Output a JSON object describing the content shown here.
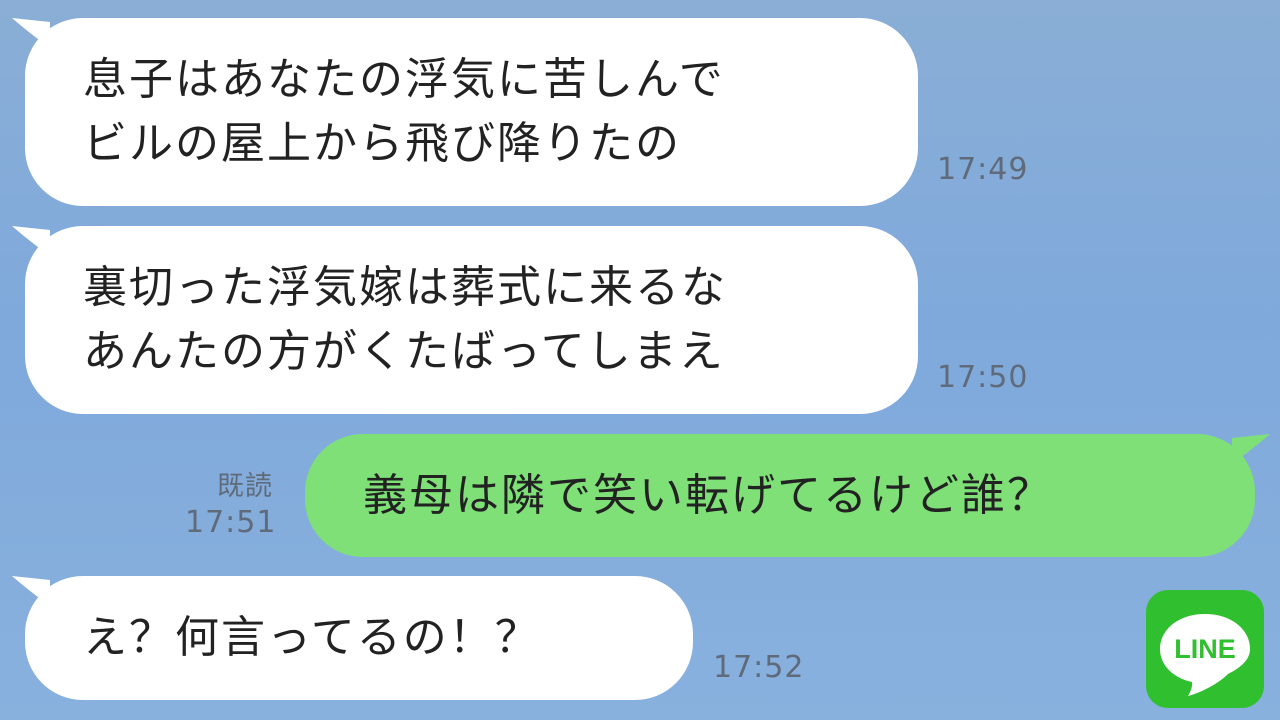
{
  "messages": [
    {
      "side": "incoming",
      "lines": [
        "息子はあなたの浮気に苦しんで",
        "ビルの屋上から飛び降りたの"
      ],
      "time": "17:49"
    },
    {
      "side": "incoming",
      "lines": [
        "裏切った浮気嫁は葬式に来るな",
        "あんたの方がくたばってしまえ"
      ],
      "time": "17:50"
    },
    {
      "side": "outgoing",
      "lines": [
        "義母は隣で笑い転げてるけど誰？"
      ],
      "read": "既読",
      "time": "17:51"
    },
    {
      "side": "incoming",
      "lines": [
        "え？何言ってるの！？"
      ],
      "time": "17:52"
    }
  ],
  "logo": {
    "text": "LINE",
    "color": "#2fbf2f",
    "icon": "line-app-icon"
  },
  "colors": {
    "incoming_bubble": "#ffffff",
    "outgoing_bubble": "#7ee077",
    "background": "#82abd9",
    "timestamp": "#5f6b7a"
  }
}
